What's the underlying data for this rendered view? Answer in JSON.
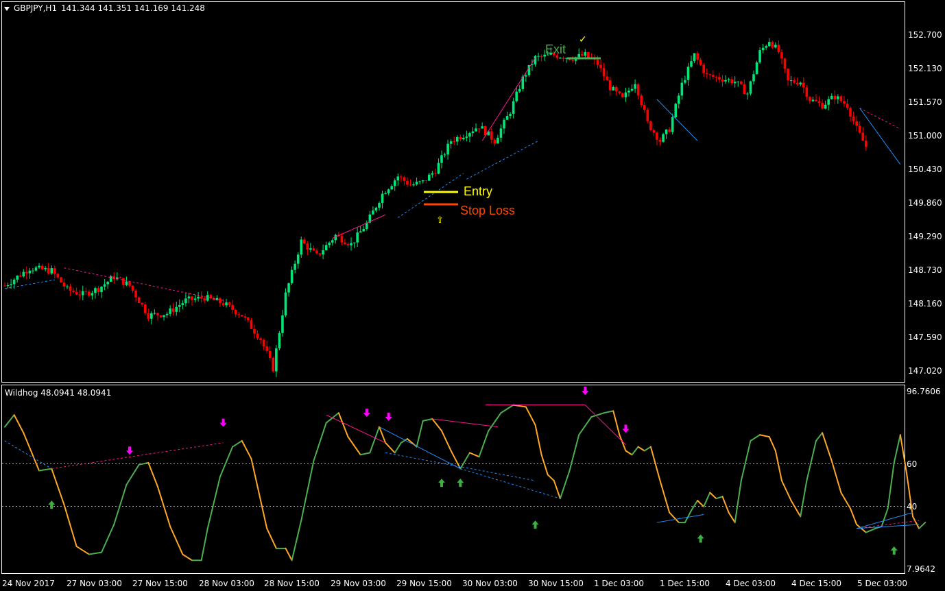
{
  "header": {
    "symbol_label": "GBPJPY,H1",
    "ohlc_values": "141.344 141.351 141.169 141.248",
    "indicator_label": "Wildhog 48.0941 48.0941"
  },
  "annotations": {
    "entry_label": "Entry",
    "stop_loss_label": "Stop Loss",
    "exit_label": "Exit"
  },
  "colors": {
    "background": "#000000",
    "frame": "#ffffff",
    "bull_candle": "#00e676",
    "bear_candle": "#ff0000",
    "oscillator_up": "#4caf50",
    "oscillator_down": "#ffa726",
    "bear_divergence": "#ff1493",
    "bull_divergence": "#1e90ff",
    "up_arrow": "#3cb043",
    "down_arrow": "#ff00ff",
    "entry_line": "#ffff00",
    "stop_loss_line": "#ff4500",
    "exit_line": "#4caf50",
    "axis_text": "#ffffff"
  },
  "chart_data": [
    {
      "type": "candlestick",
      "symbol": "GBPJPY",
      "timeframe": "H1",
      "y_ticks": [
        "152.700",
        "152.130",
        "151.570",
        "151.000",
        "150.430",
        "149.860",
        "149.290",
        "148.730",
        "148.160",
        "147.590",
        "147.020"
      ],
      "ylim": [
        147.02,
        152.7
      ],
      "x_ticks": [
        "24 Nov 2017",
        "27 Nov 03:00",
        "27 Nov 15:00",
        "28 Nov 03:00",
        "28 Nov 15:00",
        "29 Nov 03:00",
        "29 Nov 15:00",
        "30 Nov 03:00",
        "30 Nov 15:00",
        "1 Dec 03:00",
        "1 Dec 15:00",
        "4 Dec 03:00",
        "4 Dec 15:00",
        "5 Dec 03:00"
      ],
      "close_path": [
        [
          0,
          148.45
        ],
        [
          8,
          148.75
        ],
        [
          15,
          148.7
        ],
        [
          20,
          148.38
        ],
        [
          25,
          148.3
        ],
        [
          30,
          148.4
        ],
        [
          35,
          148.6
        ],
        [
          40,
          148.45
        ],
        [
          46,
          147.95
        ],
        [
          52,
          147.98
        ],
        [
          58,
          148.2
        ],
        [
          64,
          148.25
        ],
        [
          70,
          148.15
        ],
        [
          76,
          147.95
        ],
        [
          82,
          147.55
        ],
        [
          86,
          147.05
        ],
        [
          90,
          148.3
        ],
        [
          95,
          149.2
        ],
        [
          100,
          148.95
        ],
        [
          106,
          149.3
        ],
        [
          111,
          149.15
        ],
        [
          116,
          149.5
        ],
        [
          121,
          150.0
        ],
        [
          126,
          150.3
        ],
        [
          130,
          150.15
        ],
        [
          134,
          150.2
        ],
        [
          138,
          150.4
        ],
        [
          143,
          150.9
        ],
        [
          147,
          151.0
        ],
        [
          152,
          151.15
        ],
        [
          157,
          150.9
        ],
        [
          162,
          151.4
        ],
        [
          166,
          151.95
        ],
        [
          170,
          152.3
        ],
        [
          176,
          152.35
        ],
        [
          182,
          152.3
        ],
        [
          186,
          152.35
        ],
        [
          190,
          152.2
        ],
        [
          194,
          151.8
        ],
        [
          198,
          151.6
        ],
        [
          202,
          151.9
        ],
        [
          206,
          151.2
        ],
        [
          210,
          150.9
        ],
        [
          213,
          151.1
        ],
        [
          217,
          151.85
        ],
        [
          221,
          152.35
        ],
        [
          225,
          152.0
        ],
        [
          230,
          151.95
        ],
        [
          234,
          151.9
        ],
        [
          238,
          151.7
        ],
        [
          242,
          152.4
        ],
        [
          245,
          152.6
        ],
        [
          248,
          152.4
        ],
        [
          251,
          151.9
        ],
        [
          255,
          151.9
        ],
        [
          258,
          151.6
        ],
        [
          262,
          151.5
        ],
        [
          266,
          151.65
        ],
        [
          270,
          151.5
        ],
        [
          273,
          151.1
        ],
        [
          276,
          150.8
        ]
      ],
      "annotations": [
        {
          "label": "Entry",
          "price": 150.2
        },
        {
          "label": "Stop Loss",
          "price": 149.9
        },
        {
          "label": "Exit",
          "price": 152.35
        }
      ]
    },
    {
      "type": "line",
      "name": "Wildhog",
      "value": 48.0941,
      "y_ticks": [
        "96.7606",
        "60",
        "40",
        "7.9642"
      ],
      "ylim": [
        7.9642,
        96.7606
      ],
      "levels": [
        60,
        40
      ],
      "points": [
        [
          0,
          79
        ],
        [
          3,
          85
        ],
        [
          6,
          76
        ],
        [
          11,
          57
        ],
        [
          15,
          58
        ],
        [
          19,
          40
        ],
        [
          23,
          19
        ],
        [
          27,
          15
        ],
        [
          31,
          16
        ],
        [
          35,
          30
        ],
        [
          39,
          50
        ],
        [
          43,
          60
        ],
        [
          46,
          61
        ],
        [
          49,
          49
        ],
        [
          53,
          29
        ],
        [
          57,
          15
        ],
        [
          60,
          12
        ],
        [
          63,
          12
        ],
        [
          65,
          28
        ],
        [
          69,
          54
        ],
        [
          73,
          69
        ],
        [
          76,
          72
        ],
        [
          79,
          63
        ],
        [
          81,
          49
        ],
        [
          84,
          28
        ],
        [
          87,
          18
        ],
        [
          90,
          18
        ],
        [
          92,
          12
        ],
        [
          95,
          32
        ],
        [
          99,
          62
        ],
        [
          103,
          81
        ],
        [
          107,
          86
        ],
        [
          110,
          74
        ],
        [
          114,
          65
        ],
        [
          117,
          66
        ],
        [
          120,
          79
        ],
        [
          122,
          71
        ],
        [
          125,
          66
        ],
        [
          127,
          71
        ],
        [
          129,
          73
        ],
        [
          132,
          69
        ],
        [
          134,
          82
        ],
        [
          137,
          83
        ],
        [
          140,
          77
        ],
        [
          143,
          67
        ],
        [
          146,
          58
        ],
        [
          149,
          66
        ],
        [
          152,
          64
        ],
        [
          155,
          77
        ],
        [
          159,
          86
        ],
        [
          163,
          90
        ],
        [
          167,
          89
        ],
        [
          170,
          80
        ],
        [
          172,
          65
        ],
        [
          174,
          55
        ],
        [
          176,
          52
        ],
        [
          178,
          43
        ],
        [
          181,
          57
        ],
        [
          184,
          75
        ],
        [
          188,
          84
        ],
        [
          192,
          86
        ],
        [
          195,
          87
        ],
        [
          197,
          75
        ],
        [
          199,
          67
        ],
        [
          201,
          65
        ],
        [
          203,
          69
        ],
        [
          205,
          67
        ],
        [
          207,
          69
        ],
        [
          210,
          52
        ],
        [
          213,
          36
        ],
        [
          216,
          31
        ],
        [
          218,
          31
        ],
        [
          220,
          37
        ],
        [
          222,
          42
        ],
        [
          224,
          39
        ],
        [
          226,
          46
        ],
        [
          228,
          43
        ],
        [
          230,
          44
        ],
        [
          232,
          36
        ],
        [
          234,
          31
        ],
        [
          236,
          52
        ],
        [
          239,
          72
        ],
        [
          242,
          75
        ],
        [
          245,
          74
        ],
        [
          247,
          67
        ],
        [
          249,
          52
        ],
        [
          252,
          42
        ],
        [
          255,
          34
        ],
        [
          257,
          52
        ],
        [
          260,
          72
        ],
        [
          262,
          76
        ],
        [
          265,
          62
        ],
        [
          268,
          46
        ],
        [
          271,
          38
        ],
        [
          273,
          30
        ],
        [
          276,
          26
        ],
        [
          279,
          28
        ],
        [
          281,
          29
        ],
        [
          283,
          38
        ],
        [
          285,
          61
        ],
        [
          287,
          75
        ],
        [
          289,
          56
        ],
        [
          291,
          34
        ],
        [
          293,
          28
        ],
        [
          295,
          31
        ]
      ]
    }
  ]
}
